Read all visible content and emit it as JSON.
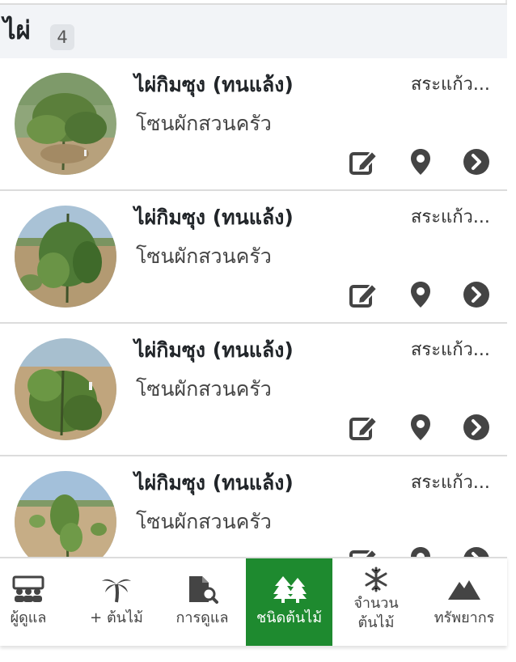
{
  "group": {
    "title": "ไผ่",
    "count": "4"
  },
  "items": [
    {
      "name": "ไผ่กิมซุง (ทนแล้ง)",
      "zone": "โซนผักสวนครัว",
      "location": "สระแก้ว..."
    },
    {
      "name": "ไผ่กิมซุง (ทนแล้ง)",
      "zone": "โซนผักสวนครัว",
      "location": "สระแก้ว..."
    },
    {
      "name": "ไผ่กิมซุง (ทนแล้ง)",
      "zone": "โซนผักสวนครัว",
      "location": "สระแก้ว..."
    },
    {
      "name": "ไผ่กิมซุง (ทนแล้ง)",
      "zone": "โซนผักสวนครัว",
      "location": "สระแก้ว..."
    }
  ],
  "nav": {
    "caretakers": "ผู้ดูแล",
    "add_tree": "+ ต้นไม้",
    "care": "การดูแล",
    "species": "ชนิดต้นไม้",
    "count_line1": "จำนวน",
    "count_line2": "ต้นไม้",
    "resources": "ทรัพยากร"
  },
  "colors": {
    "active": "#1e8a2f",
    "icon": "#444444",
    "header_bg": "#f2f4f7"
  }
}
